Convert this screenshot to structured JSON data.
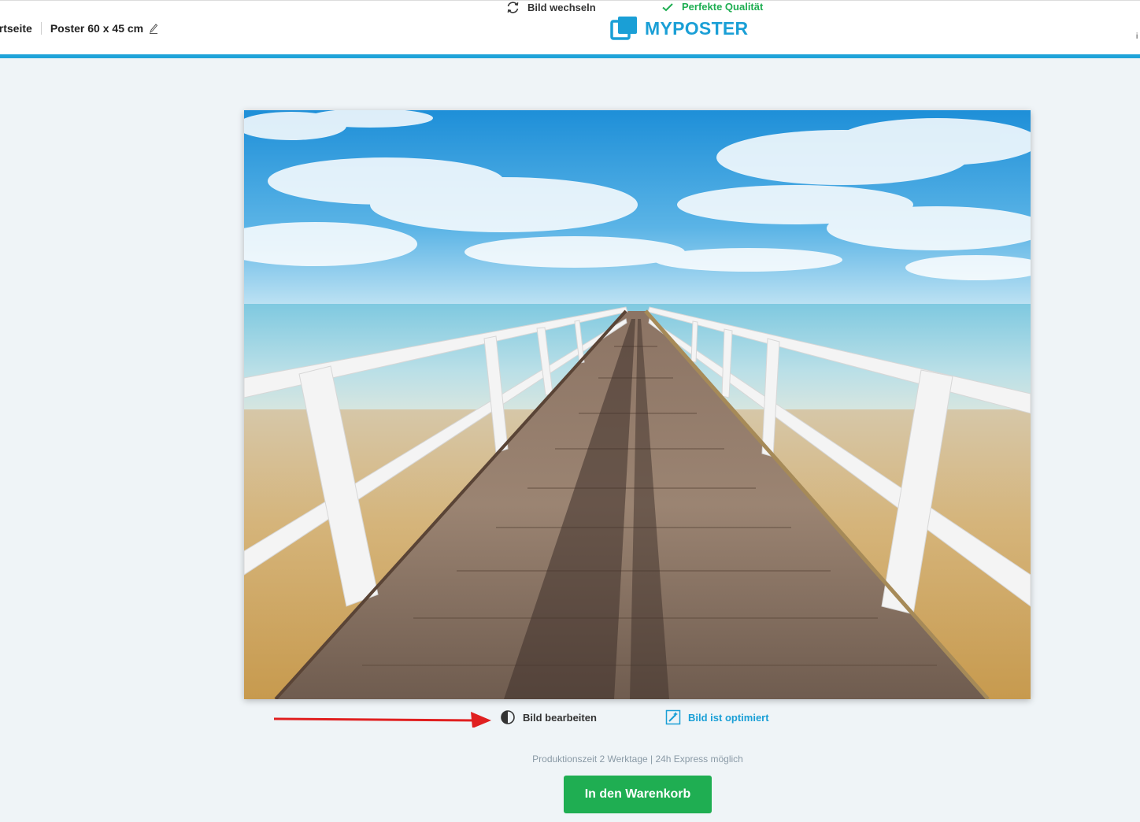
{
  "header": {
    "breadcrumb_home": "Startseite",
    "breadcrumb_product": "Poster 60 x 45 cm",
    "logo_text": "MYPOSTER",
    "edit_icon": "pencil-icon",
    "edge_glyph": "i"
  },
  "colors": {
    "accent": "#1fa3d9",
    "success": "#1fae52",
    "background": "#eff4f7",
    "arrow": "#e02020"
  },
  "top_actions": {
    "change_image": {
      "label": "Bild wechseln",
      "icon": "refresh-icon"
    },
    "quality": {
      "label": "Perfekte Qualität",
      "icon": "check-icon"
    }
  },
  "poster": {
    "description_icon": "pier-photo"
  },
  "bottom_actions": {
    "edit_image": {
      "label": "Bild bearbeiten",
      "icon": "contrast-icon"
    },
    "optimized": {
      "label": "Bild ist optimiert",
      "icon": "magic-wand-icon"
    }
  },
  "production_note": "Produktionszeit 2 Werktage | 24h Express möglich",
  "cart_button": {
    "label": "In den Warenkorb"
  }
}
